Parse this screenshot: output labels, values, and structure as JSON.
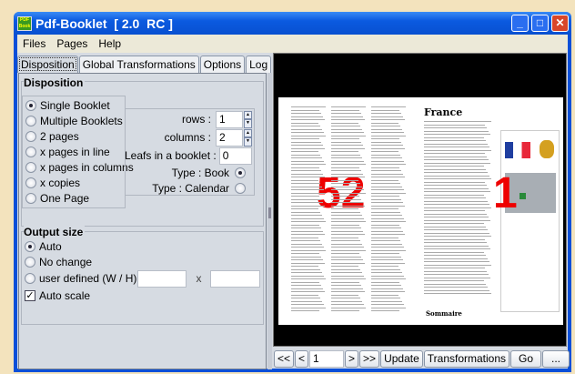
{
  "window": {
    "title": "Pdf-Booklet  [ 2.0  RC ]",
    "logo_text": "Pdf Book",
    "minimize": "_",
    "maximize": "□",
    "close": "✕"
  },
  "menu": [
    "Files",
    "Pages",
    "Help"
  ],
  "tabs": [
    "Disposition",
    "Global Transformations",
    "Options",
    "Log"
  ],
  "disposition": {
    "legend": "Disposition",
    "options": [
      {
        "label": "Single Booklet",
        "selected": true
      },
      {
        "label": "Multiple Booklets",
        "selected": false
      },
      {
        "label": "2 pages",
        "selected": false
      },
      {
        "label": "x pages in line",
        "selected": false
      },
      {
        "label": "x pages in columns",
        "selected": false
      },
      {
        "label": "x copies",
        "selected": false
      },
      {
        "label": "One Page",
        "selected": false
      }
    ],
    "rows_label": "rows :",
    "rows": "1",
    "columns_label": "columns :",
    "columns": "2",
    "leafs_label": "Leafs in a booklet :",
    "leafs": "0",
    "type_book": "Type : Book",
    "type_calendar": "Type : Calendar",
    "type_selected": "book"
  },
  "output": {
    "legend": "Output size",
    "auto": "Auto",
    "no_change": "No change",
    "user_defined": "user defined (W / H)",
    "width": "",
    "height": "",
    "x": "x",
    "auto_scale": "Auto scale",
    "auto_scale_checked": true,
    "selected": "auto"
  },
  "preview": {
    "left_page": "52",
    "right_page": "1",
    "heading": "France",
    "summary": "Sommaire"
  },
  "nav": {
    "first": "<<",
    "prev": "<",
    "page": "1",
    "next": ">",
    "last": ">>",
    "update": "Update",
    "transformations": "Transformations",
    "go": "Go",
    "more": "..."
  }
}
